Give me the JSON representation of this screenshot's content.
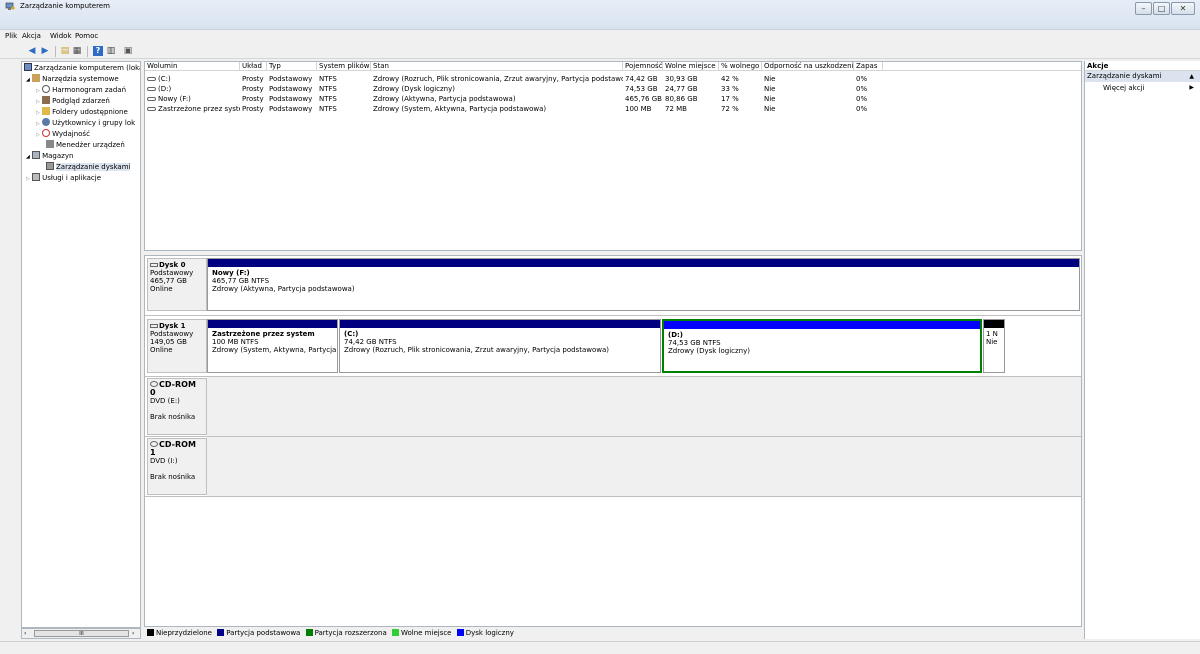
{
  "window": {
    "title": "Zarządzanie komputerem",
    "btn_min": "–",
    "btn_max": "□",
    "btn_close": "✕"
  },
  "menu": [
    "Plik",
    "Akcja",
    "Widok",
    "Pomoc"
  ],
  "toolbar": [
    "back-icon",
    "forward-icon",
    "up-folder-icon",
    "show-pane-icon",
    "help-icon",
    "properties-icon",
    "disk-icon"
  ],
  "tree": {
    "items": [
      {
        "label": "Zarządzanie komputerem (lokal",
        "icon": "computer-icon",
        "indent": 0,
        "expander": ""
      },
      {
        "label": "Narzędzia systemowe",
        "icon": "tools-icon",
        "indent": 1,
        "expander": "◢"
      },
      {
        "label": "Harmonogram zadań",
        "icon": "clock-icon",
        "indent": 2,
        "expander": "▷"
      },
      {
        "label": "Podgląd zdarzeń",
        "icon": "event-viewer-icon",
        "indent": 2,
        "expander": "▷"
      },
      {
        "label": "Foldery udostępnione",
        "icon": "shared-folder-icon",
        "indent": 2,
        "expander": "▷"
      },
      {
        "label": "Użytkownicy i grupy lok",
        "icon": "users-icon",
        "indent": 2,
        "expander": "▷"
      },
      {
        "label": "Wydajność",
        "icon": "performance-icon",
        "indent": 2,
        "expander": "▷"
      },
      {
        "label": "Menedżer urządzeń",
        "icon": "device-manager-icon",
        "indent": 2,
        "expander": ""
      },
      {
        "label": "Magazyn",
        "icon": "storage-icon",
        "indent": 1,
        "expander": "◢"
      },
      {
        "label": "Zarządzanie dyskami",
        "icon": "disk-management-icon",
        "indent": 2,
        "expander": ""
      },
      {
        "label": "Usługi i aplikacje",
        "icon": "services-icon",
        "indent": 1,
        "expander": "▷"
      }
    ],
    "hscroll_grip": "III"
  },
  "volumes": {
    "headers": [
      "Wolumin",
      "Układ",
      "Typ",
      "System plików",
      "Stan",
      "Pojemność",
      "Wolne miejsce",
      "% wolnego",
      "Odporność na uszkodzenia",
      "Zapas"
    ],
    "rows": [
      [
        "(C:)",
        "Prosty",
        "Podstawowy",
        "NTFS",
        "Zdrowy (Rozruch, Plik stronicowania, Zrzut awaryjny, Partycja podstawowa)",
        "74,42 GB",
        "30,93 GB",
        "42 %",
        "Nie",
        "0%"
      ],
      [
        "(D:)",
        "Prosty",
        "Podstawowy",
        "NTFS",
        "Zdrowy (Dysk logiczny)",
        "74,53 GB",
        "24,77 GB",
        "33 %",
        "Nie",
        "0%"
      ],
      [
        "Nowy (F:)",
        "Prosty",
        "Podstawowy",
        "NTFS",
        "Zdrowy (Aktywna, Partycja podstawowa)",
        "465,76 GB",
        "80,86 GB",
        "17 %",
        "Nie",
        "0%"
      ],
      [
        "Zastrzeżone przez system",
        "Prosty",
        "Podstawowy",
        "NTFS",
        "Zdrowy (System, Aktywna, Partycja podstawowa)",
        "100 MB",
        "72 MB",
        "72 %",
        "Nie",
        "0%"
      ]
    ]
  },
  "disks": [
    {
      "name": "Dysk 0",
      "type": "Podstawowy",
      "size": "465,77 GB",
      "status": "Online",
      "partitions": [
        {
          "title": "Nowy (F:)",
          "size": "465,77 GB NTFS",
          "status": "Zdrowy (Aktywna, Partycja podstawowa)"
        }
      ]
    },
    {
      "name": "Dysk 1",
      "type": "Podstawowy",
      "size": "149,05 GB",
      "status": "Online",
      "partitions": [
        {
          "title": "Zastrzeżone przez system",
          "size": "100 MB NTFS",
          "status": "Zdrowy (System, Aktywna, Partycja podstawowa)"
        },
        {
          "title": "(C:)",
          "size": "74,42 GB NTFS",
          "status": "Zdrowy (Rozruch, Plik stronicowania, Zrzut awaryjny, Partycja podstawowa)"
        },
        {
          "title": "(D:)",
          "size": "74,53 GB NTFS",
          "status": "Zdrowy (Dysk logiczny)"
        },
        {
          "title": "",
          "size": "1 N",
          "status": "Nie"
        }
      ]
    },
    {
      "name": "CD-ROM 0",
      "type": "DVD (E:)",
      "status": "Brak nośnika"
    },
    {
      "name": "CD-ROM 1",
      "type": "DVD (I:)",
      "status": "Brak nośnika"
    }
  ],
  "legend": [
    {
      "label": "Nieprzydzielone",
      "color": "#000000"
    },
    {
      "label": "Partycja podstawowa",
      "color": "#00008b"
    },
    {
      "label": "Partycja rozszerzona",
      "color": "#008000"
    },
    {
      "label": "Wolne miejsce",
      "color": "#32cd32"
    },
    {
      "label": "Dysk logiczny",
      "color": "#0000ff"
    }
  ],
  "actions": {
    "header": "Akcje",
    "section": "Zarządzanie dyskami",
    "more": "Więcej akcji"
  },
  "colors": {
    "primary_partition": "#000080",
    "logical_drive": "#0000ff",
    "unallocated": "#000000",
    "selected_border": "#008000"
  }
}
